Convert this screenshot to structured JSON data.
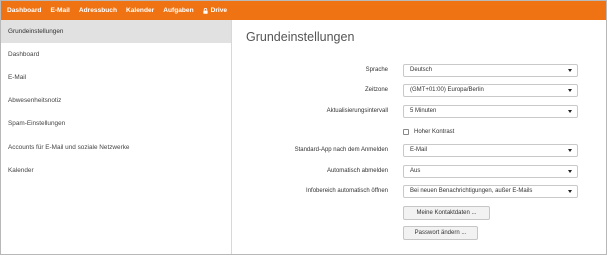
{
  "topnav": {
    "items": [
      {
        "label": "Dashboard"
      },
      {
        "label": "E-Mail"
      },
      {
        "label": "Adressbuch"
      },
      {
        "label": "Kalender"
      },
      {
        "label": "Aufgaben"
      },
      {
        "label": "Drive",
        "icon": "lock-icon"
      }
    ]
  },
  "sidebar": {
    "items": [
      {
        "label": "Grundeinstellungen",
        "active": true
      },
      {
        "label": "Dashboard"
      },
      {
        "label": "E-Mail"
      },
      {
        "label": "Abwesenheitsnotiz"
      },
      {
        "label": "Spam-Einstellungen"
      },
      {
        "label": "Accounts für E-Mail und soziale Netzwerke"
      },
      {
        "label": "Kalender"
      }
    ]
  },
  "main": {
    "title": "Grundeinstellungen",
    "fields": {
      "language": {
        "label": "Sprache",
        "value": "Deutsch"
      },
      "timezone": {
        "label": "Zeitzone",
        "value": "(GMT+01:00) Europa/Berlin"
      },
      "refresh": {
        "label": "Aktualisierungsintervall",
        "value": "5 Minuten"
      },
      "high_contrast": {
        "label": "Hoher Kontrast",
        "checked": false
      },
      "default_app": {
        "label": "Standard-App nach dem Anmelden",
        "value": "E-Mail"
      },
      "auto_logout": {
        "label": "Automatisch abmelden",
        "value": "Aus"
      },
      "infopanel": {
        "label": "Infobereich automatisch öffnen",
        "value": "Bei neuen Benachrichtigungen, außer E-Mails"
      }
    },
    "buttons": {
      "contact_data": "Meine Kontaktdaten ...",
      "change_password": "Passwort ändern ..."
    }
  },
  "colors": {
    "accent": "#f07313",
    "sidebar_active": "#e1e1e1"
  }
}
